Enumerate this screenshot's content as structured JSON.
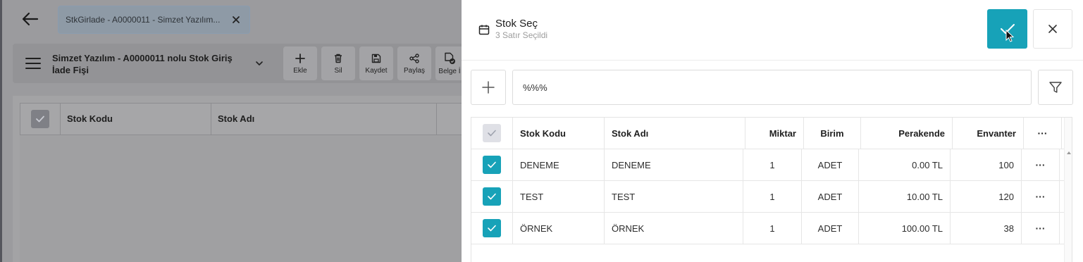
{
  "background": {
    "tab_label": "StkGirlade - A0000011 - Simzet Yazılım...",
    "doc_title": "Simzet Yazılım - A0000011 nolu Stok Giriş İade Fişi",
    "toolbar": [
      {
        "label": "Ekle",
        "icon": "plus-icon"
      },
      {
        "label": "Sil",
        "icon": "trash-icon"
      },
      {
        "label": "Kaydet",
        "icon": "save-icon"
      },
      {
        "label": "Paylaş",
        "icon": "share-icon"
      },
      {
        "label": "Belge İ",
        "icon": "document-check-icon"
      }
    ],
    "grid_columns": [
      "Stok Kodu",
      "Stok Adı"
    ]
  },
  "dialog": {
    "title": "Stok Seç",
    "subtitle": "3 Satır Seçildi",
    "search_value": "%%%",
    "accent_color": "#17a2b8",
    "columns": {
      "code": "Stok Kodu",
      "name": "Stok Adı",
      "qty": "Miktar",
      "unit": "Birim",
      "retail": "Perakende",
      "inventory": "Envanter",
      "more": "···"
    },
    "rows": [
      {
        "code": "DENEME",
        "name": "DENEME",
        "qty": "1",
        "unit": "ADET",
        "retail": "0.00 TL",
        "inventory": "100",
        "more": "···",
        "selected": true
      },
      {
        "code": "TEST",
        "name": "TEST",
        "qty": "1",
        "unit": "ADET",
        "retail": "10.00 TL",
        "inventory": "120",
        "more": "···",
        "selected": true
      },
      {
        "code": "ÖRNEK",
        "name": "ÖRNEK",
        "qty": "1",
        "unit": "ADET",
        "retail": "100.00 TL",
        "inventory": "38",
        "more": "···",
        "selected": true
      }
    ]
  }
}
